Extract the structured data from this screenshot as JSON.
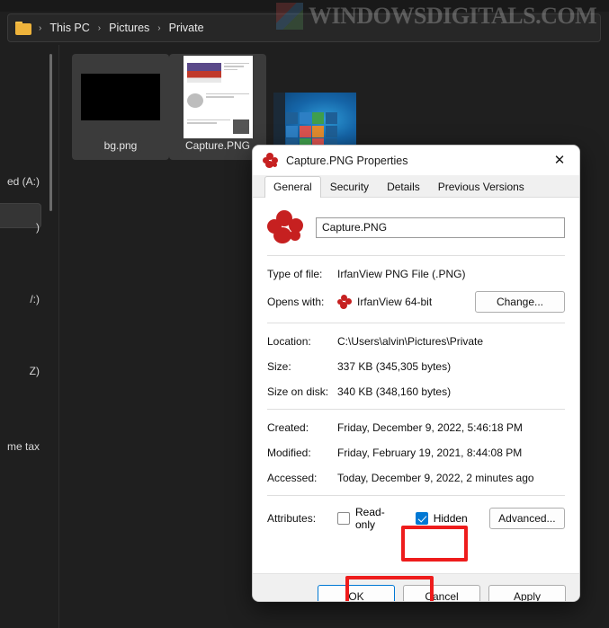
{
  "explorer": {
    "breadcrumb": {
      "folder_icon": "folder-icon",
      "separator": "›",
      "items": [
        "This PC",
        "Pictures",
        "Private"
      ]
    },
    "watermark": {
      "text_main": "INDOWS",
      "text_lead": "W",
      "text_mid": "D",
      "text_tail": "IGITALS.COM",
      "full": "WINDOWSDIGITALS.COM"
    },
    "files": [
      {
        "name": "bg.png",
        "thumb": "black-image-thumbnail",
        "selected": true
      },
      {
        "name": "Capture.PNG",
        "thumb": "document-screenshot-thumbnail",
        "selected": true
      },
      {
        "name": "",
        "thumb": "windows-desktop-thumbnail",
        "selected": false
      }
    ],
    "sidebar": {
      "items": [
        {
          "label": "ed (A:)"
        },
        {
          "label": ")"
        },
        {
          "label": "/:)"
        },
        {
          "label": "Z)"
        },
        {
          "label": "me tax"
        }
      ]
    }
  },
  "dialog": {
    "title": "Capture.PNG Properties",
    "icon": "irfanview-icon",
    "close_label": "✕",
    "tabs": [
      {
        "label": "General",
        "active": true
      },
      {
        "label": "Security",
        "active": false
      },
      {
        "label": "Details",
        "active": false
      },
      {
        "label": "Previous Versions",
        "active": false
      }
    ],
    "filename_value": "Capture.PNG",
    "fields": [
      {
        "label": "Type of file:",
        "value": "IrfanView PNG File (.PNG)"
      },
      {
        "label": "Location:",
        "value": "C:\\Users\\alvin\\Pictures\\Private"
      },
      {
        "label": "Size:",
        "value": "337 KB (345,305 bytes)"
      },
      {
        "label": "Size on disk:",
        "value": "340 KB (348,160 bytes)"
      },
      {
        "label": "Created:",
        "value": "Friday, December 9, 2022, 5:46:18 PM"
      },
      {
        "label": "Modified:",
        "value": "Friday, February 19, 2021, 8:44:08 PM"
      },
      {
        "label": "Accessed:",
        "value": "Today, December 9, 2022, 2 minutes ago"
      }
    ],
    "opens_with": {
      "label": "Opens with:",
      "app": "IrfanView 64-bit",
      "change_button": "Change..."
    },
    "attributes": {
      "label": "Attributes:",
      "readonly_label": "Read-only",
      "readonly_checked": false,
      "hidden_label": "Hidden",
      "hidden_checked": true,
      "advanced_button": "Advanced..."
    },
    "buttons": {
      "ok": "OK",
      "cancel": "Cancel",
      "apply": "Apply"
    }
  },
  "annotations": {
    "color": "#ee1c1c",
    "targets": [
      "hidden-checkbox",
      "ok-button"
    ]
  }
}
